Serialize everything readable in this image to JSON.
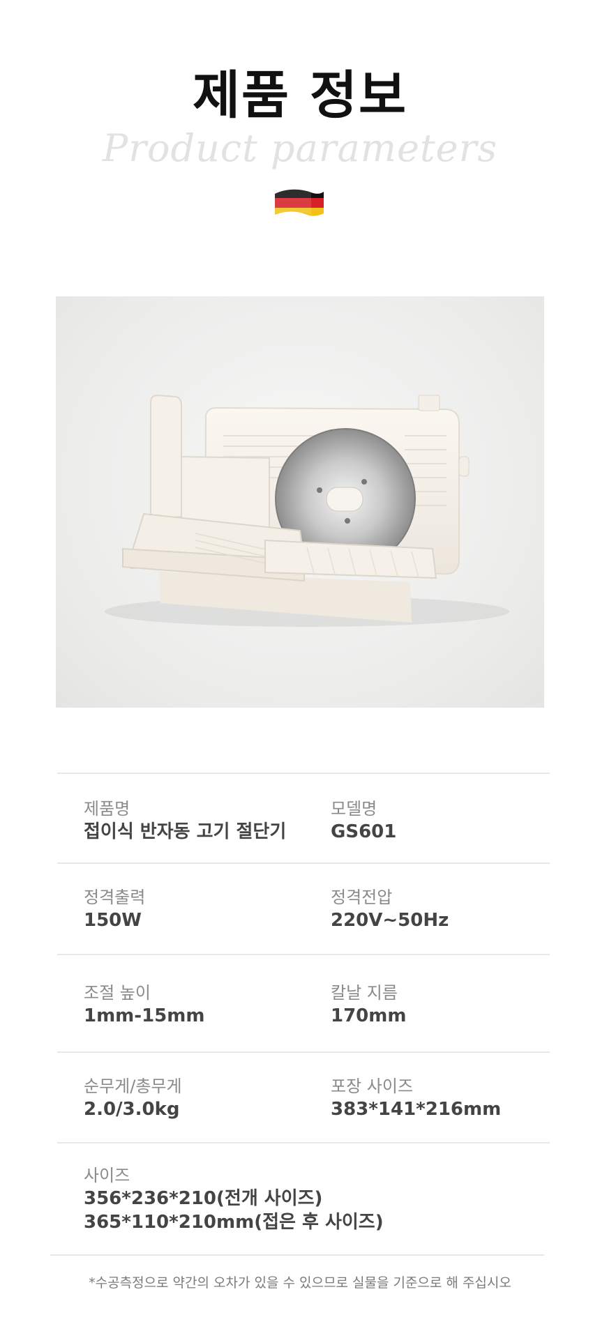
{
  "header": {
    "title": "제품 정보",
    "subtitle": "Product parameters",
    "flag_icon": "germany-flag-icon",
    "flag_colors": [
      "#111111",
      "#d6202a",
      "#f2c21b"
    ]
  },
  "product_image": {
    "icon": "meat-slicer-photo",
    "background": "#ecedeb"
  },
  "specs": {
    "rows": [
      {
        "left_label": "제품명",
        "left_value": "접이식 반자동 고기 절단기",
        "right_label": "모델명",
        "right_value": "GS601"
      },
      {
        "left_label": "정격출력",
        "left_value": "150W",
        "right_label": "정격전압",
        "right_value": "220V~50Hz"
      },
      {
        "left_label": "조절 높이",
        "left_value": "1mm-15mm",
        "right_label": "칼날 지름",
        "right_value": "170mm"
      },
      {
        "left_label": "순무게/총무게",
        "left_value": "2.0/3.0kg",
        "right_label": "포장 사이즈",
        "right_value": "383*141*216mm"
      }
    ],
    "size": {
      "label": "사이즈",
      "value_1": "356*236*210(전개 사이즈)",
      "value_2": "365*110*210mm(접은 후 사이즈)"
    }
  },
  "footnote": "*수공측정으로 약간의 오차가 있을 수 있으므로 실물을 기준으로 해 주십시오"
}
